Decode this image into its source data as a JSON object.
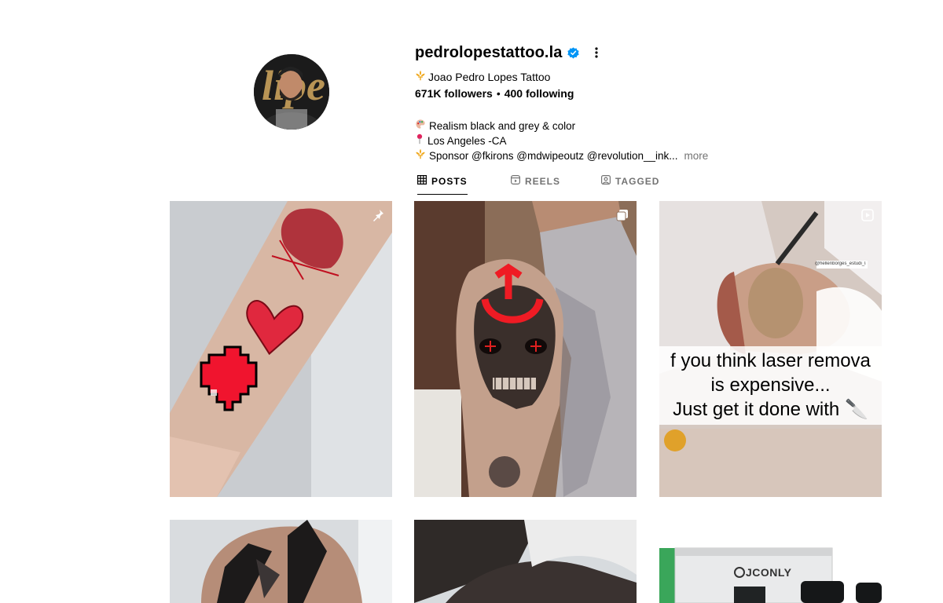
{
  "profile": {
    "username": "pedrolopestattoo.la",
    "full_name": "Joao Pedro Lopes Tattoo",
    "followers": "671K followers",
    "following": "400 following",
    "separator": "•",
    "bio": [
      {
        "icon": "palette-icon",
        "text": "Realism black and grey & color"
      },
      {
        "icon": "pin-icon",
        "text": "Los Angeles -CA"
      },
      {
        "icon": "fleur-de-lis-icon",
        "text": "Sponsor @fkirons @mdwipeoutz @revolution__ink..."
      }
    ],
    "more_label": "more"
  },
  "tabs": [
    {
      "label": "POSTS",
      "active": true
    },
    {
      "label": "REELS",
      "active": false
    },
    {
      "label": "TAGGED",
      "active": false
    }
  ],
  "posts": [
    {
      "type": "image",
      "pinned": true,
      "overlay_text": []
    },
    {
      "type": "carousel",
      "pinned": false,
      "overlay_text": []
    },
    {
      "type": "video",
      "pinned": false,
      "overlay_text": [
        "f you think laser remova",
        "is expensive...",
        "Just get it done with 🔪"
      ],
      "watermark": "@hellenborges_estudi_laser"
    },
    {
      "type": "image",
      "pinned": false,
      "overlay_text": []
    },
    {
      "type": "image",
      "pinned": false,
      "overlay_text": []
    },
    {
      "type": "image",
      "pinned": false,
      "overlay_text": [],
      "brand": "JCONLY"
    }
  ],
  "colors": {
    "verified": "#0095f6",
    "muted": "#737373",
    "gold": "#f0a81c",
    "pin": "#e0245e"
  }
}
